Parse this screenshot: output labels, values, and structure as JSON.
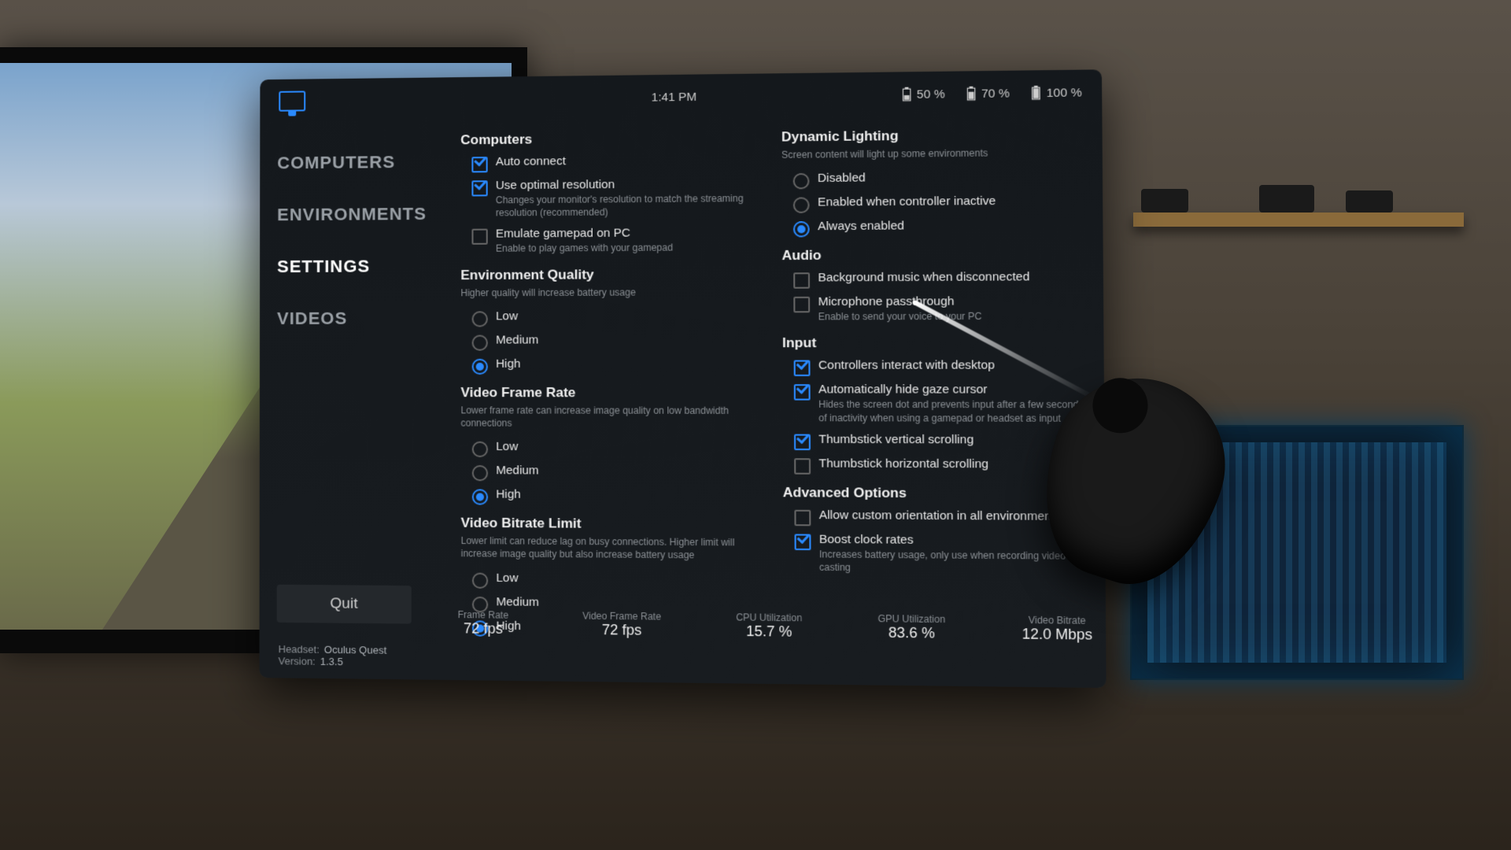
{
  "topbar": {
    "time": "1:41 PM",
    "batteries": [
      "50 %",
      "70 %",
      "100 %"
    ]
  },
  "sidebar": {
    "items": [
      "COMPUTERS",
      "ENVIRONMENTS",
      "SETTINGS",
      "VIDEOS"
    ],
    "active": 2,
    "quit": "Quit"
  },
  "left": {
    "computers": {
      "title": "Computers",
      "auto_connect": "Auto connect",
      "use_optimal": "Use optimal resolution",
      "use_optimal_sub": "Changes your monitor's resolution to match the streaming resolution (recommended)",
      "emulate": "Emulate gamepad on PC",
      "emulate_sub": "Enable to play games with your gamepad"
    },
    "env": {
      "title": "Environment Quality",
      "sub": "Higher quality will increase battery usage",
      "opts": [
        "Low",
        "Medium",
        "High"
      ]
    },
    "vfr": {
      "title": "Video Frame Rate",
      "sub": "Lower frame rate can increase image quality on low bandwidth connections",
      "opts": [
        "Low",
        "Medium",
        "High"
      ]
    },
    "vbl": {
      "title": "Video Bitrate Limit",
      "sub": "Lower limit can reduce lag on busy connections. Higher limit will increase image quality but also increase battery usage",
      "opts": [
        "Low",
        "Medium",
        "High"
      ]
    }
  },
  "right": {
    "dyn": {
      "title": "Dynamic Lighting",
      "sub": "Screen content will light up some environments",
      "opts": [
        "Disabled",
        "Enabled when controller inactive",
        "Always enabled"
      ]
    },
    "audio": {
      "title": "Audio",
      "bg_music": "Background music when disconnected",
      "mic": "Microphone passthrough",
      "mic_sub": "Enable to send your voice to your PC"
    },
    "input": {
      "title": "Input",
      "ctrl_desktop": "Controllers interact with desktop",
      "auto_hide": "Automatically hide gaze cursor",
      "auto_hide_sub": "Hides the screen dot and prevents input after a few seconds of inactivity when using a gamepad or headset as input",
      "tvs": "Thumbstick vertical scrolling",
      "ths": "Thumbstick horizontal scrolling"
    },
    "adv": {
      "title": "Advanced Options",
      "allow_orient": "Allow custom orientation in all environments",
      "boost": "Boost clock rates",
      "boost_sub": "Increases battery usage, only use when recording video or casting"
    }
  },
  "metrics": [
    {
      "label": "Frame Rate",
      "value": "72 fps"
    },
    {
      "label": "Video Frame Rate",
      "value": "72 fps"
    },
    {
      "label": "CPU Utilization",
      "value": "15.7 %"
    },
    {
      "label": "GPU Utilization",
      "value": "83.6 %"
    },
    {
      "label": "Video Bitrate",
      "value": "12.0 Mbps"
    }
  ],
  "footer": {
    "headset_label": "Headset:",
    "headset": "Oculus Quest",
    "version_label": "Version:",
    "version": "1.3.5"
  }
}
